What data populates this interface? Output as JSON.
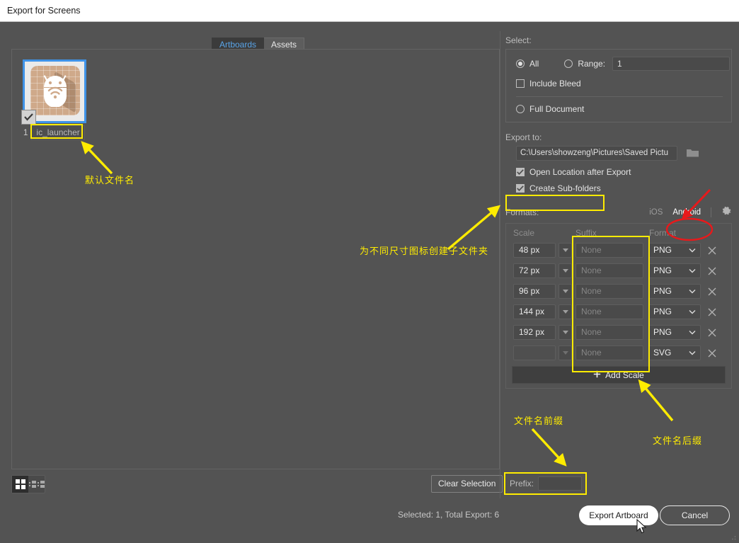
{
  "window": {
    "title": "Export for Screens"
  },
  "tabs": [
    {
      "label": "Artboards",
      "active": true
    },
    {
      "label": "Assets",
      "active": false
    }
  ],
  "artboards": [
    {
      "index": "1",
      "name": "ic_launcher",
      "selected": true,
      "checked": true
    }
  ],
  "view_toggle": {
    "grid_label": "grid-view",
    "list_label": "list-view",
    "active": "grid"
  },
  "left_footer": {
    "clear_selection_label": "Clear Selection",
    "prefix_label": "Prefix:",
    "prefix_value": "",
    "prefix_placeholder": ""
  },
  "select": {
    "heading": "Select:",
    "all_label": "All",
    "all_checked": true,
    "range_label": "Range:",
    "range_checked": false,
    "range_value": "1",
    "include_bleed_label": "Include Bleed",
    "include_bleed_checked": false,
    "full_document_label": "Full Document",
    "full_document_checked": false
  },
  "export_to": {
    "heading": "Export to:",
    "path": "C:\\Users\\showzeng\\Pictures\\Saved Pictu",
    "browse_icon": "folder-icon",
    "open_location_label": "Open Location after Export",
    "open_location_checked": true,
    "create_subfolders_label": "Create Sub-folders",
    "create_subfolders_checked": true
  },
  "formats": {
    "heading": "Formats:",
    "platforms": [
      {
        "label": "iOS",
        "active": false
      },
      {
        "label": "Android",
        "active": true
      }
    ],
    "settings_icon": "gear-icon",
    "columns": {
      "scale": "Scale",
      "suffix": "Suffix",
      "format": "Format"
    },
    "rows": [
      {
        "scale": "48 px",
        "suffix": "",
        "suffix_placeholder": "None",
        "format": "PNG"
      },
      {
        "scale": "72 px",
        "suffix": "",
        "suffix_placeholder": "None",
        "format": "PNG"
      },
      {
        "scale": "96 px",
        "suffix": "",
        "suffix_placeholder": "None",
        "format": "PNG"
      },
      {
        "scale": "144 px",
        "suffix": "",
        "suffix_placeholder": "None",
        "format": "PNG"
      },
      {
        "scale": "192 px",
        "suffix": "",
        "suffix_placeholder": "None",
        "format": "PNG"
      },
      {
        "scale": "",
        "suffix": "",
        "suffix_placeholder": "None",
        "format": "SVG"
      }
    ],
    "add_scale_label": "Add Scale",
    "add_scale_icon": "plus-icon",
    "delete_icon": "close-icon"
  },
  "footer": {
    "status": "Selected: 1, Total Export: 6",
    "export_label": "Export Artboard",
    "cancel_label": "Cancel"
  },
  "annotations": {
    "color": "#ffec00",
    "accent_red": "#e8191b",
    "default_filename": "默认文件名",
    "create_subfolder_note": "为不同尺寸图标创建子文件夹",
    "filename_prefix": "文件名前缀",
    "filename_suffix": "文件名后缀"
  }
}
